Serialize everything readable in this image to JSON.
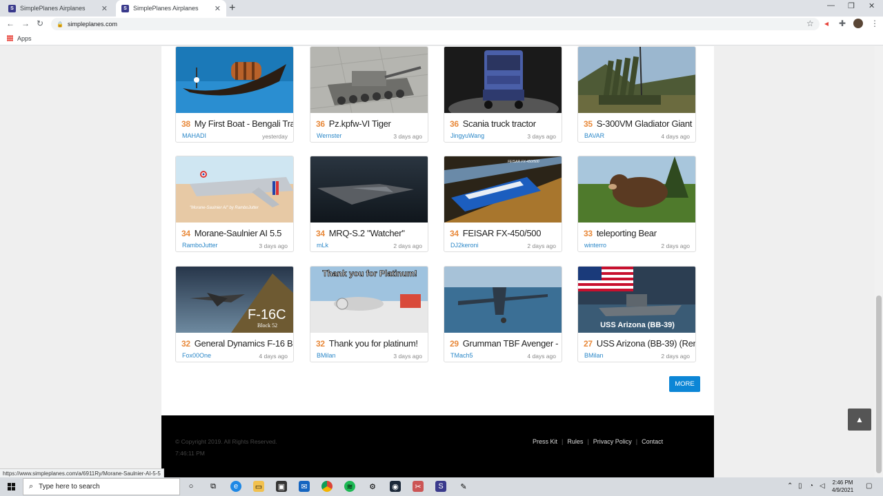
{
  "browser": {
    "tabs": [
      {
        "title": "SimplePlanes Airplanes",
        "close": "✕"
      },
      {
        "title": "SimplePlanes Airplanes",
        "close": "✕"
      }
    ],
    "new_tab": "+",
    "url": "simpleplanes.com",
    "bookmarks_label": "Apps",
    "window": {
      "minimize": "—",
      "maximize": "❐",
      "close": "✕"
    }
  },
  "cards": [
    {
      "score": "38",
      "title": "My First Boat - Bengali Tra",
      "user": "MAHADI",
      "time": "yesterday"
    },
    {
      "score": "36",
      "title": "Pz.kpfw-VI Tiger",
      "user": "Wernster",
      "time": "3 days ago"
    },
    {
      "score": "36",
      "title": "Scania truck tractor",
      "user": "JingyuWang",
      "time": "3 days ago"
    },
    {
      "score": "35",
      "title": "S-300VM Gladiator Giant",
      "user": "BAVAR",
      "time": "4 days ago"
    },
    {
      "score": "34",
      "title": "Morane-Saulnier AI 5.5",
      "user": "RamboJutter",
      "time": "3 days ago"
    },
    {
      "score": "34",
      "title": "MRQ-S.2 \"Watcher\"",
      "user": "mLk",
      "time": "2 days ago"
    },
    {
      "score": "34",
      "title": "FEISAR FX-450/500",
      "user": "DJ2keroni",
      "time": "2 days ago"
    },
    {
      "score": "33",
      "title": "teleporting Bear",
      "user": "winterro",
      "time": "2 days ago"
    },
    {
      "score": "32",
      "title": "General Dynamics F-16 B",
      "user": "Fox00One",
      "time": "4 days ago"
    },
    {
      "score": "32",
      "title": "Thank you for platinum!",
      "user": "BMilan",
      "time": "3 days ago"
    },
    {
      "score": "29",
      "title": "Grumman TBF Avenger -",
      "user": "TMach5",
      "time": "4 days ago"
    },
    {
      "score": "27",
      "title": "USS Arizona (BB-39) (Rem",
      "user": "BMilan",
      "time": "2 days ago"
    }
  ],
  "thumb_text": {
    "morane_caption": "\"Morane-Saulnier AI\" by RamboJutter",
    "feisar_caption": "FEISAR FX-450/500",
    "f16": "F-16C",
    "f16_sub": "Block 52",
    "thankyou": "Thank you for Platinum!",
    "arizona": "USS Arizona (BB-39)"
  },
  "more_label": "MORE",
  "footer": {
    "copyright": "© Copyright 2019. All Rights Reserved.",
    "clock": "7:46:11 PM",
    "links": [
      "Press Kit",
      "Rules",
      "Privacy Policy",
      "Contact"
    ]
  },
  "status_url": "https://www.simpleplanes.com/a/6911Ry/Morane-Saulnier-AI-5-5",
  "taskbar": {
    "search_placeholder": "Type here to search",
    "time": "2:46 PM",
    "date": "4/9/2021"
  }
}
